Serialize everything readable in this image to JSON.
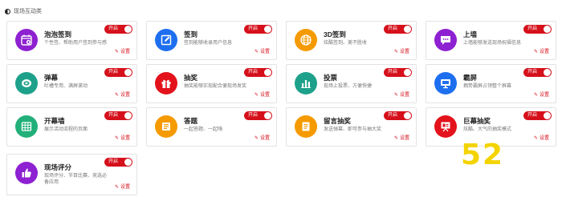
{
  "header": {
    "title": "现场互动类"
  },
  "common": {
    "toggle_label": "开启",
    "settings_label": "设置"
  },
  "colors": {
    "accent": "#d5101b",
    "purple": "#8e21d1",
    "blue": "#1e6ff0",
    "orange": "#f59a00",
    "teal": "#1ea18b",
    "red": "#e3121b",
    "green": "#22b07a",
    "watermark": "#f3d400"
  },
  "cards": [
    {
      "title": "泡泡签到",
      "desc": "个性签、帮助用户签到参与感",
      "icon": "calendar-add-icon",
      "color": "#8e21d1"
    },
    {
      "title": "签到",
      "desc": "签到能够收录用户信息",
      "icon": "edit-icon",
      "color": "#1e6ff0"
    },
    {
      "title": "3D签到",
      "desc": "炫酷签到、美不胜收",
      "icon": "globe-icon",
      "color": "#f59a00"
    },
    {
      "title": "上墙",
      "desc": "上墙能够发送现场祝福信息",
      "icon": "chat-icon",
      "color": "#8e21d1"
    },
    {
      "title": "弹幕",
      "desc": "吐槽专用、满屏滚动",
      "icon": "bullet-comment-icon",
      "color": "#1ea18b"
    },
    {
      "title": "抽奖",
      "desc": "抽奖能够实现配合便现场发奖",
      "icon": "gift-icon",
      "color": "#e3121b"
    },
    {
      "title": "投票",
      "desc": "现场上投票、方便快捷",
      "icon": "bar-chart-icon",
      "color": "#1ea18b"
    },
    {
      "title": "霸屏",
      "desc": "拥势霸屏占领整个屏幕",
      "icon": "screen-icon",
      "color": "#1e6ff0"
    },
    {
      "title": "开幕墙",
      "desc": "展示活动流程的页面",
      "icon": "grid-wall-icon",
      "color": "#22b07a"
    },
    {
      "title": "答题",
      "desc": "一起答题、一起嗨",
      "icon": "quiz-icon",
      "color": "#f59a00"
    },
    {
      "title": "留言抽奖",
      "desc": "发送弹幕、即可参与抽大奖",
      "icon": "note-icon",
      "color": "#f59a00"
    },
    {
      "title": "巨幕抽奖",
      "desc": "炫酷、大气的抽奖模式",
      "icon": "presentation-icon",
      "color": "#e3121b"
    },
    {
      "title": "现场评分",
      "desc": "现场评分、节目比赛、竞选必备应用",
      "icon": "thumbs-up-icon",
      "color": "#8e21d1"
    }
  ],
  "watermark": {
    "text": "52"
  }
}
